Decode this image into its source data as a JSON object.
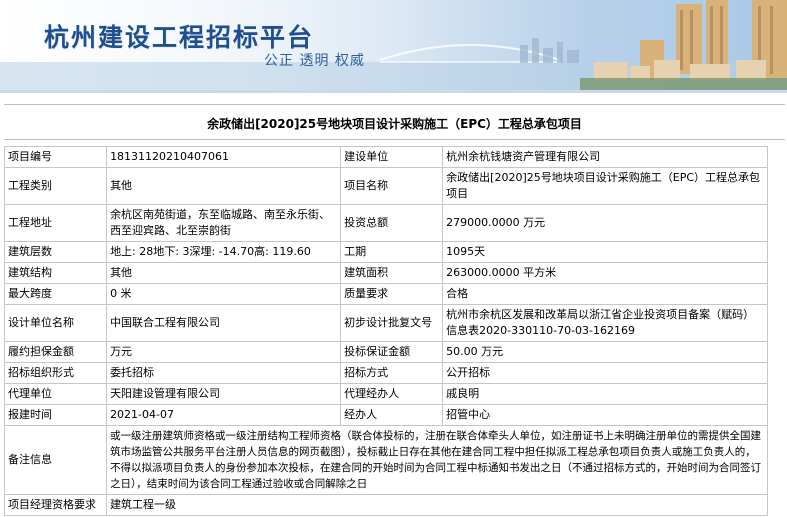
{
  "header": {
    "title": "杭州建设工程招标平台",
    "slogan": "公正  透明  权威"
  },
  "project": {
    "title": "余政储出[2020]25号地块项目设计采购施工（EPC）工程总承包项目"
  },
  "fields": {
    "project_no_label": "项目编号",
    "project_no": "18131120210407061",
    "builder_label": "建设单位",
    "builder": "杭州余杭钱塘资产管理有限公司",
    "category_label": "工程类别",
    "category": "其他",
    "project_name_label": "项目名称",
    "project_name": "余政储出[2020]25号地块项目设计采购施工（EPC）工程总承包项目",
    "address_label": "工程地址",
    "address": "余杭区南苑街道，东至临城路、南至永乐街、西至迎宾路、北至崇韵街",
    "investment_label": "投资总额",
    "investment": "279000.0000 万元",
    "floors_label": "建筑层数",
    "floors": "地上: 28地下: 3深埋: -14.70高: 119.60",
    "period_label": "工期",
    "period": " 1095天",
    "structure_label": "建筑结构",
    "structure": "其他",
    "area_label": "建筑面积",
    "area": "263000.0000 平方米",
    "span_label": "最大跨度",
    "span": "0 米",
    "quality_label": "质量要求",
    "quality": "合格",
    "designer_label": "设计单位名称",
    "designer": "中国联合工程有限公司",
    "approval_label": "初步设计批复文号",
    "approval": "杭州市余杭区发展和改革局以浙江省企业投资项目备案（赋码）信息表2020-330110-70-03-162169",
    "performance_label": "履约担保金额",
    "performance": " 万元",
    "bid_bond_label": "投标保证金额",
    "bid_bond": "50.00 万元",
    "org_form_label": "招标组织形式",
    "org_form": "委托招标",
    "method_label": "招标方式",
    "method": "公开招标",
    "agent_label": "代理单位",
    "agent": "天阳建设管理有限公司",
    "agent_person_label": "代理经办人",
    "agent_person": "戚良明",
    "report_time_label": "报建时间",
    "report_time": " 2021-04-07",
    "handler_label": "经办人",
    "handler": " 招管中心",
    "remark_label": "备注信息",
    "remark": "或一级注册建筑师资格或一级注册结构工程师资格（联合体投标的，注册在联合体牵头人单位，如注册证书上未明确注册单位的需提供全国建筑市场监管公共服务平台注册人员信息的网页截图），投标截止日存在其他在建合同工程中担任拟派工程总承包项目负责人或施工负责人的，不得以拟派项目负责人的身份参加本次投标，在建合同的开始时间为合同工程中标通知书发出之日（不通过招标方式的，开始时间为合同签订之日），结束时间为该合同工程通过验收或合同解除之日",
    "manager_qual_label": "项目经理资格要求",
    "manager_qual": "建筑工程一级"
  },
  "colors": {
    "banner_title": "#1f4f8f",
    "border": "#c6c6c6"
  }
}
